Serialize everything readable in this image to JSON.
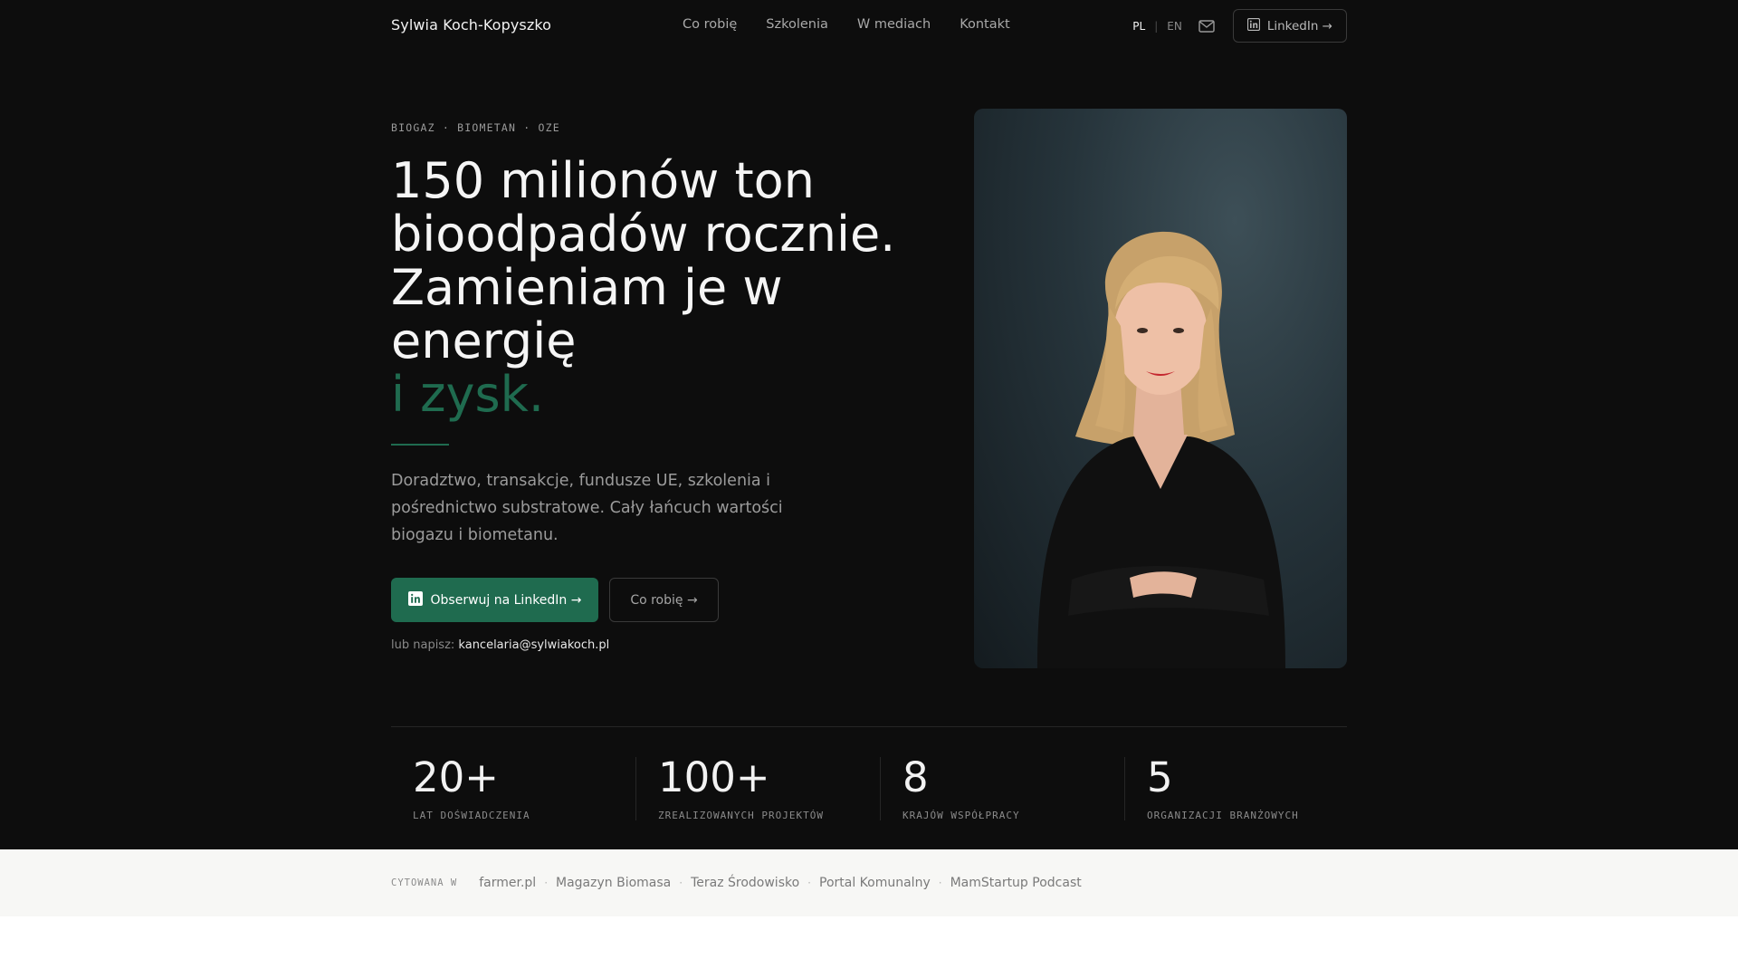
{
  "nav": {
    "brand": "Sylwia Koch-Kopyszko",
    "links": [
      "Co robię",
      "Szkolenia",
      "W mediach",
      "Kontakt"
    ],
    "lang_active": "PL",
    "lang_inactive": "EN",
    "linkedin_label": "LinkedIn →"
  },
  "hero": {
    "eyebrow": "BIOGAZ · BIOMETAN · OZE",
    "headline": "150 milionów ton bioodpadów rocznie. Zamieniam je w energię",
    "headline_accent": "i zysk.",
    "lead": "Doradztwo, transakcje, fundusze UE, szkolenia i pośrednictwo substratowe. Cały łańcuch wartości biogazu i biometanu.",
    "primary_button": "Obserwuj na LinkedIn →",
    "secondary_button": "Co robię →",
    "contact_prefix": "lub napisz:",
    "contact_email": "kancelaria@sylwiakoch.pl"
  },
  "stats": [
    {
      "value": "20+",
      "label": "LAT DOŚWIADCZENIA"
    },
    {
      "value": "100+",
      "label": "ZREALIZOWANYCH PROJEKTÓW"
    },
    {
      "value": "8",
      "label": "KRAJÓW WSPÓŁPRACY"
    },
    {
      "value": "5",
      "label": "ORGANIZACJI BRANŻOWYCH"
    }
  ],
  "press": {
    "label": "CYTOWANA W",
    "items": [
      "farmer.pl",
      "Magazyn Biomasa",
      "Teraz Środowisko",
      "Portal Komunalny",
      "MamStartup Podcast"
    ]
  },
  "colors": {
    "background": "#0d0d0d",
    "accent": "#1f6b4f",
    "press_bar": "#f7f7f5"
  },
  "icons": [
    "linkedin-icon",
    "mail-icon"
  ]
}
